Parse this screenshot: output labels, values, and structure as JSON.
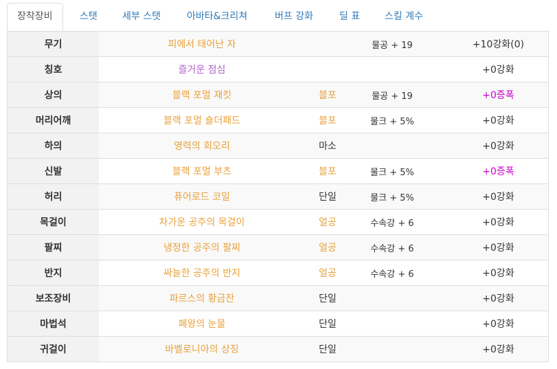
{
  "tabs": [
    {
      "label": "장착장비",
      "active": true
    },
    {
      "label": "스탯",
      "active": false
    },
    {
      "label": "세부 스탯",
      "active": false
    },
    {
      "label": "아바타&크리쳐",
      "active": false
    },
    {
      "label": "버프 강화",
      "active": false
    },
    {
      "label": "딜 표",
      "active": false
    },
    {
      "label": "스킬 계수",
      "active": false
    }
  ],
  "colors": {
    "tab_link": "#337ab7",
    "item_name": "#e8a13a",
    "title_name": "#b062c9",
    "amplify": "#cc00cc",
    "border": "#dddddd",
    "slot_bg": "#f2f2f2"
  },
  "equipment": [
    {
      "slot": "무기",
      "name": "피에서 태어난 자",
      "set": "",
      "option": "물공 + 19",
      "enhance": "+10강화(0)"
    },
    {
      "slot": "칭호",
      "name": "즐거운 점심",
      "set": "",
      "option": "",
      "enhance": "+0강화"
    },
    {
      "slot": "상의",
      "name": "블랙 포멀 재킷",
      "set": "블포",
      "option": "물공 + 19",
      "enhance": "+0증폭"
    },
    {
      "slot": "머리어깨",
      "name": "블랙 포멀 숄더패드",
      "set": "블포",
      "option": "물크 + 5%",
      "enhance": "+0강화"
    },
    {
      "slot": "하의",
      "name": "영력의 회오리",
      "set": "마소",
      "option": "",
      "enhance": "+0강화"
    },
    {
      "slot": "신발",
      "name": "블랙 포멀 부츠",
      "set": "블포",
      "option": "물크 + 5%",
      "enhance": "+0증폭"
    },
    {
      "slot": "허리",
      "name": "퓨어로드 코일",
      "set": "단일",
      "option": "물크 + 5%",
      "enhance": "+0강화"
    },
    {
      "slot": "목걸이",
      "name": "차가운 공주의 목걸이",
      "set": "얼공",
      "option": "수속강 + 6",
      "enhance": "+0강화"
    },
    {
      "slot": "팔찌",
      "name": "냉정한 공주의 팔찌",
      "set": "얼공",
      "option": "수속강 + 6",
      "enhance": "+0강화"
    },
    {
      "slot": "반지",
      "name": "싸늘한 공주의 반지",
      "set": "얼공",
      "option": "수속강 + 6",
      "enhance": "+0강화"
    },
    {
      "slot": "보조장비",
      "name": "파르스의 황금잔",
      "set": "단일",
      "option": "",
      "enhance": "+0강화"
    },
    {
      "slot": "마법석",
      "name": "폐왕의 눈물",
      "set": "단일",
      "option": "",
      "enhance": "+0강화"
    },
    {
      "slot": "귀걸이",
      "name": "바벨로니아의 상징",
      "set": "단일",
      "option": "",
      "enhance": "+0강화"
    }
  ]
}
